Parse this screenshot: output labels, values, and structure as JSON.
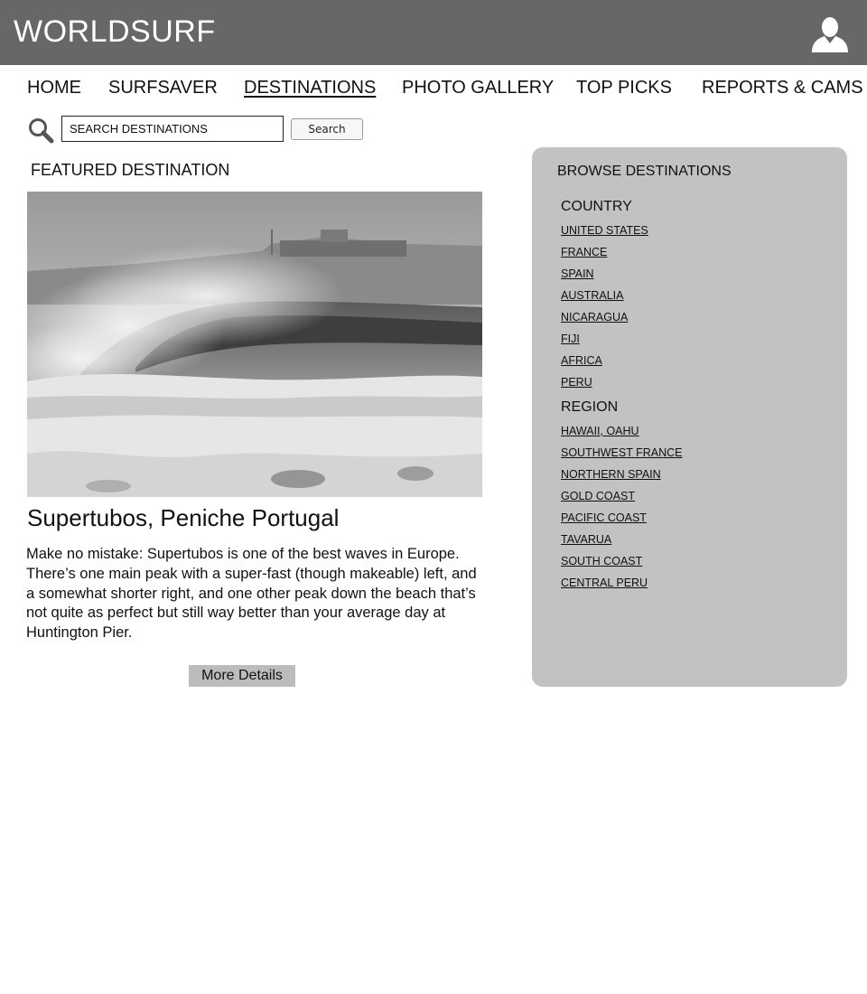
{
  "header": {
    "logo": "WORLDSURF",
    "user_icon": "user-silhouette-icon",
    "background": "#676767"
  },
  "nav": {
    "items": [
      {
        "label": "HOME"
      },
      {
        "label": "SURFSAVER"
      },
      {
        "label": "DESTINATIONS",
        "active": true
      },
      {
        "label": "PHOTO GALLERY"
      },
      {
        "label": "TOP PICKS"
      },
      {
        "label": "REPORTS & CAMS"
      }
    ]
  },
  "search": {
    "icon": "search-icon",
    "value": "SEARCH DESTINATIONS",
    "button_label": "Search"
  },
  "featured": {
    "heading": "FEATURED DESTINATION",
    "image": "wave-photo",
    "title": "Supertubos, Peniche Portugal",
    "description": "Make no mistake: Supertubos is one of the best waves in Europe. There’s one main peak with a super-fast (though makeable) left, and a somewhat shorter right, and one other peak down the beach that’s not quite as perfect but still way better than your average day at Huntington Pier.",
    "button_label": "More Details"
  },
  "browse": {
    "title": "BROWSE DESTINATIONS",
    "country": {
      "heading": "COUNTRY",
      "items": [
        "UNITED STATES",
        "FRANCE",
        "SPAIN",
        "AUSTRALIA",
        "NICARAGUA",
        "FIJI",
        "AFRICA",
        "PERU"
      ]
    },
    "region": {
      "heading": "REGION",
      "items": [
        "HAWAII, OAHU",
        "SOUTHWEST FRANCE",
        "NORTHERN SPAIN",
        "GOLD COAST",
        "PACIFIC COAST",
        "TAVARUA",
        "SOUTH COAST",
        "CENTRAL PERU"
      ]
    },
    "background": "#c2c2c2"
  }
}
